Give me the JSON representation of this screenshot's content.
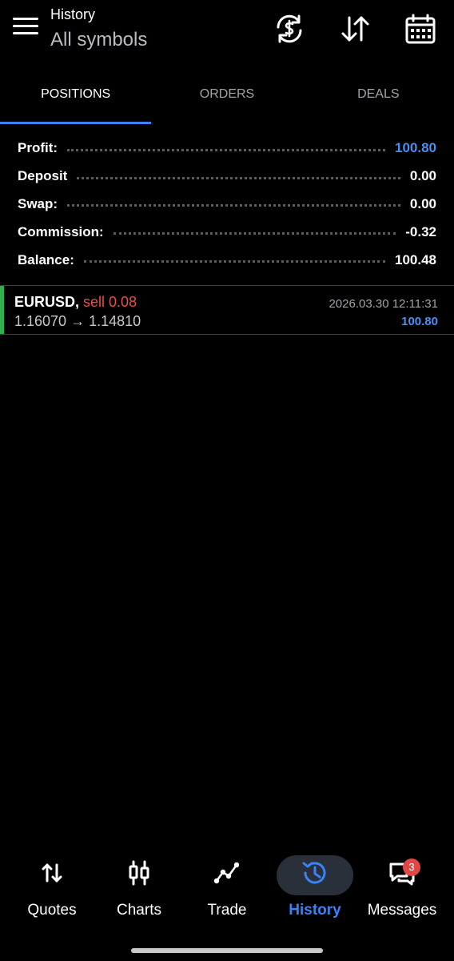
{
  "header": {
    "title": "History",
    "subtitle": "All symbols",
    "icons": [
      "menu-icon",
      "currency-refresh-icon",
      "sort-icon",
      "calendar-icon"
    ]
  },
  "tabs": [
    {
      "label": "POSITIONS",
      "active": true
    },
    {
      "label": "ORDERS",
      "active": false
    },
    {
      "label": "DEALS",
      "active": false
    }
  ],
  "summary": [
    {
      "label": "Profit:",
      "value": "100.80"
    },
    {
      "label": "Deposit",
      "value": "0.00"
    },
    {
      "label": "Swap:",
      "value": "0.00"
    },
    {
      "label": "Commission:",
      "value": "-0.32"
    },
    {
      "label": "Balance:",
      "value": "100.48"
    }
  ],
  "deal": {
    "symbol": "EURUSD,",
    "side": "sell 0.08",
    "prices": "1.16070 → 1.14810",
    "time": "2026.03.30 12:11:31",
    "profit": "100.80"
  },
  "bottom_nav": [
    {
      "label": "Quotes",
      "icon": "quotes-arrows-icon"
    },
    {
      "label": "Charts",
      "icon": "candlestick-icon"
    },
    {
      "label": "Trade",
      "icon": "trade-line-icon"
    },
    {
      "label": "History",
      "icon": "history-clock-icon",
      "active": true
    },
    {
      "label": "Messages",
      "icon": "messages-icon",
      "badge": "3"
    }
  ],
  "colors": {
    "accent": "#3a82f6",
    "profit_blue": "#4a8ef2",
    "sell_red": "#ee4b4b",
    "buy_bar_green": "#2fb24a",
    "badge_red": "#e24747"
  }
}
